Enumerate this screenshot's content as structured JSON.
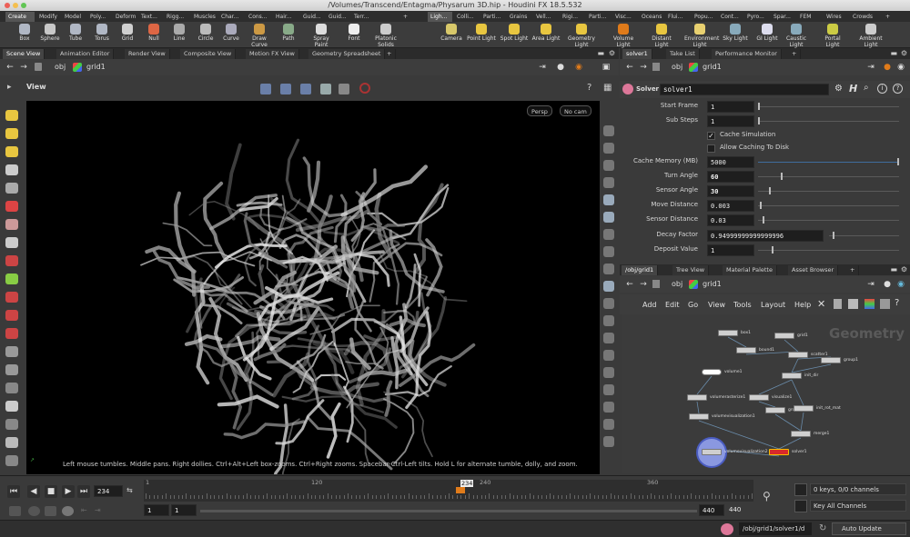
{
  "title_bar": {
    "title": "/Volumes/Transcend/Entagma/Physarum 3D.hip - Houdini FX 18.5.532"
  },
  "shelf_tabs_left": [
    "Create",
    "Modify",
    "Model",
    "Poly...",
    "Deform",
    "Text...",
    "Rigg...",
    "Muscles",
    "Char...",
    "Cons...",
    "Hair...",
    "Guid...",
    "Guid...",
    "Terr..."
  ],
  "shelf_tabs_right": [
    "Ligh...",
    "Colli...",
    "Parti...",
    "Grains",
    "Vell...",
    "Rigi...",
    "Parti...",
    "Visc...",
    "Oceans",
    "Flui...",
    "Popu...",
    "Cont...",
    "Pyro...",
    "Spar...",
    "FEM",
    "Wires",
    "Crowds"
  ],
  "shelf_tools_left": [
    "Box",
    "Sphere",
    "Tube",
    "Torus",
    "Grid",
    "Null",
    "Line",
    "Circle",
    "Curve",
    "Draw Curve",
    "Path",
    "Spray Paint",
    "Font",
    "Platonic Solids"
  ],
  "shelf_tools_right": [
    "Camera",
    "Point Light",
    "Spot Light",
    "Area Light",
    "Geometry Light",
    "Volume Light",
    "Distant Light",
    "Environment Light",
    "Sky Light",
    "GI Light",
    "Caustic Light",
    "Portal Light",
    "Ambient Light"
  ],
  "left_pane_tabs": [
    "Scene View",
    "Animation Editor",
    "Render View",
    "Composite View",
    "Motion FX View",
    "Geometry Spreadsheet"
  ],
  "left_path": {
    "context": "obj",
    "node": "grid1"
  },
  "viewport": {
    "label": "View",
    "persp_button": "Persp",
    "camera_button": "No cam",
    "hint": "Left mouse tumbles. Middle pans. Right dollies. Ctrl+Alt+Left box-zooms. Ctrl+Right zooms. Spacebar-Ctrl-Left tilts. Hold L for alternate tumble, dolly, and zoom."
  },
  "right_top_tabs": [
    "solver1",
    "Take List",
    "Performance Monitor"
  ],
  "right_path": {
    "context": "obj",
    "node": "grid1"
  },
  "params": {
    "node_type": "Solver",
    "node_name": "solver1",
    "start_frame": {
      "label": "Start Frame",
      "value": "1"
    },
    "sub_steps": {
      "label": "Sub Steps",
      "value": "1"
    },
    "cache_simulation": {
      "label": "Cache Simulation",
      "checked": "✓"
    },
    "allow_caching": {
      "label": "Allow Caching To Disk",
      "checked": ""
    },
    "cache_memory": {
      "label": "Cache Memory (MB)",
      "value": "5000"
    },
    "turn_angle": {
      "label": "Turn Angle",
      "value": "60"
    },
    "sensor_angle": {
      "label": "Sensor Angle",
      "value": "30"
    },
    "move_distance": {
      "label": "Move Distance",
      "value": "0.003"
    },
    "sensor_distance": {
      "label": "Sensor Distance",
      "value": "0.03"
    },
    "decay_factor": {
      "label": "Decay Factor",
      "value": "0.94999999999999996"
    },
    "deposit_value": {
      "label": "Deposit Value",
      "value": "1"
    }
  },
  "network_tabs": [
    "/obj/grid1",
    "Tree View",
    "Material Palette",
    "Asset Browser"
  ],
  "network_path": {
    "context": "obj",
    "node": "grid1"
  },
  "network_menu": [
    "Add",
    "Edit",
    "Go",
    "View",
    "Tools",
    "Layout",
    "Help"
  ],
  "network": {
    "watermark": "Geometry",
    "nodes": [
      "box1",
      "grid1",
      "bound1",
      "scatter1",
      "group1",
      "init_dir",
      "volume1",
      "volumerasterize1",
      "visualize1",
      "group2",
      "init_rot_mat",
      "volumevisualization1",
      "merge1",
      "solver1",
      "volumevisualization2"
    ]
  },
  "timeline": {
    "current_frame": "234",
    "range_start": "1",
    "range_start2": "1",
    "range_end": "440",
    "range_end2": "440",
    "ticks": [
      "1",
      "120",
      "240",
      "360"
    ],
    "keys_status": "0 keys, 0/0 channels",
    "key_all_channels": "Key All Channels"
  },
  "status_bar": {
    "path": "/obj/grid1/solver1/d",
    "update_mode": "Auto Update"
  },
  "colors": {
    "accent_orange": "#e07b1a",
    "node_selected": "#d9292a",
    "viewport_bg": "#000000"
  }
}
